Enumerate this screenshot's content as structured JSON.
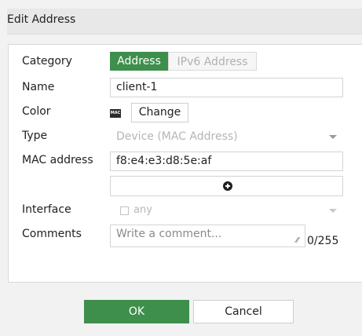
{
  "dialog": {
    "title": "Edit Address"
  },
  "form": {
    "category": {
      "label": "Category",
      "options": [
        "Address",
        "IPv6 Address"
      ],
      "selected": "Address"
    },
    "name": {
      "label": "Name",
      "value": "client-1"
    },
    "color": {
      "label": "Color",
      "icon_text": "MAC",
      "button_label": "Change"
    },
    "type": {
      "label": "Type",
      "value": "Device (MAC Address)"
    },
    "mac": {
      "label": "MAC address",
      "value": "f8:e4:e3:d8:5e:af"
    },
    "interface": {
      "label": "Interface",
      "value": "any"
    },
    "comments": {
      "label": "Comments",
      "placeholder": "Write a comment...",
      "counter": "0/255"
    }
  },
  "footer": {
    "ok_label": "OK",
    "cancel_label": "Cancel"
  },
  "colors": {
    "accent": "#3e8e4c"
  }
}
